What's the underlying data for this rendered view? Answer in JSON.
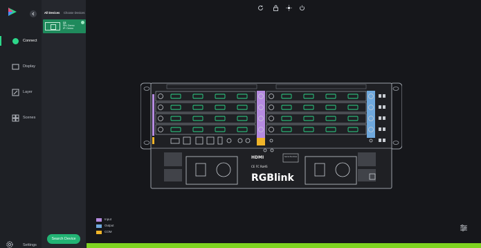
{
  "nav": {
    "items": [
      {
        "label": "Connect",
        "active": true
      },
      {
        "label": "Display",
        "active": false
      },
      {
        "label": "Layer",
        "active": false
      },
      {
        "label": "Scenes",
        "active": false
      }
    ],
    "settings_label": "Settings"
  },
  "devices": {
    "tabs": [
      "All Devices",
      "Choose Devices"
    ],
    "card": {
      "name": "Q1",
      "sn": "SN: Demo",
      "ip": "IP: Demo"
    },
    "search_label": "Search Device"
  },
  "chassis": {
    "brand": "RGBlink",
    "hdmi": "HDMI",
    "certs": "CE FC RoHS",
    "serial_label": "Serial Number"
  },
  "legend": [
    {
      "label": "Input",
      "color": "#b58be0"
    },
    {
      "label": "Output",
      "color": "#6fa8dc"
    },
    {
      "label": "COM",
      "color": "#f0b429"
    }
  ],
  "colors": {
    "accent": "#22b374",
    "progress": "#7fd321"
  },
  "progress": 1.0
}
